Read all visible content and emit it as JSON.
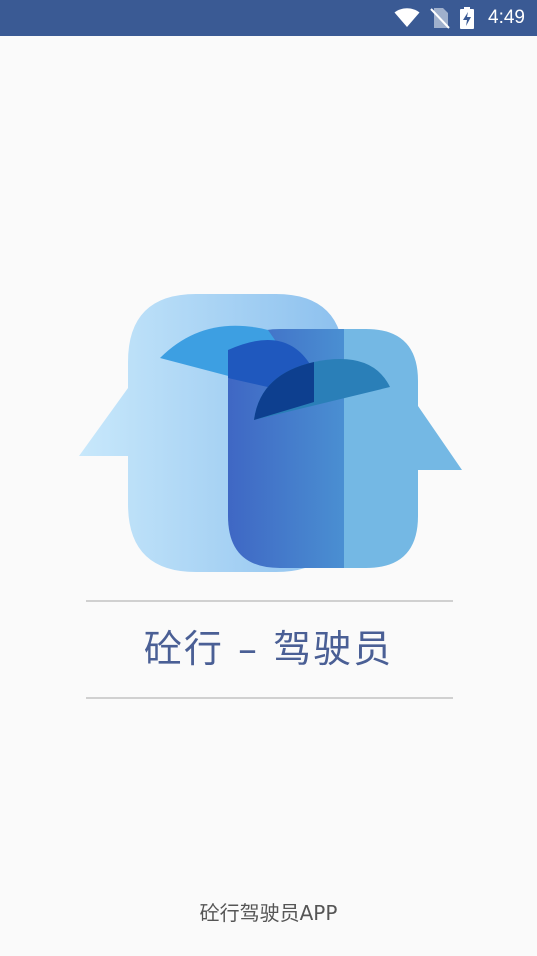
{
  "status_bar": {
    "time": "4:49",
    "icons": [
      "wifi-icon",
      "no-sim-icon",
      "battery-charging-icon"
    ],
    "background": "#3a5a94"
  },
  "splash": {
    "title": "砼行 – 驾驶员",
    "footer": "砼行驾驶员APP",
    "logo_icon": "two-heads-facing-logo",
    "title_color": "#4a5f95"
  }
}
